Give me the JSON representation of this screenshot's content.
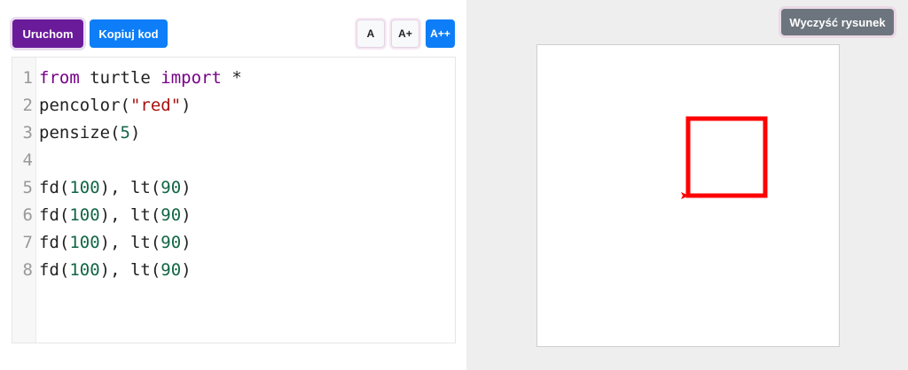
{
  "toolbar": {
    "run_label": "Uruchom",
    "copy_label": "Kopiuj kod",
    "font_small_label": "A",
    "font_medium_label": "A+",
    "font_large_label": "A++"
  },
  "canvas_toolbar": {
    "clear_label": "Wyczyść rysunek"
  },
  "editor": {
    "line_numbers": [
      "1",
      "2",
      "3",
      "4",
      "5",
      "6",
      "7",
      "8"
    ],
    "lines": [
      [
        {
          "t": "from",
          "c": "kw"
        },
        {
          "t": " turtle ",
          "c": ""
        },
        {
          "t": "import",
          "c": "kw"
        },
        {
          "t": " *",
          "c": ""
        }
      ],
      [
        {
          "t": "pencolor(",
          "c": ""
        },
        {
          "t": "\"red\"",
          "c": "str"
        },
        {
          "t": ")",
          "c": ""
        }
      ],
      [
        {
          "t": "pensize(",
          "c": ""
        },
        {
          "t": "5",
          "c": "num"
        },
        {
          "t": ")",
          "c": ""
        }
      ],
      [],
      [
        {
          "t": "fd(",
          "c": ""
        },
        {
          "t": "100",
          "c": "num"
        },
        {
          "t": "), lt(",
          "c": ""
        },
        {
          "t": "90",
          "c": "num"
        },
        {
          "t": ")",
          "c": ""
        }
      ],
      [
        {
          "t": "fd(",
          "c": ""
        },
        {
          "t": "100",
          "c": "num"
        },
        {
          "t": "), lt(",
          "c": ""
        },
        {
          "t": "90",
          "c": "num"
        },
        {
          "t": ")",
          "c": ""
        }
      ],
      [
        {
          "t": "fd(",
          "c": ""
        },
        {
          "t": "100",
          "c": "num"
        },
        {
          "t": "), lt(",
          "c": ""
        },
        {
          "t": "90",
          "c": "num"
        },
        {
          "t": ")",
          "c": ""
        }
      ],
      [
        {
          "t": "fd(",
          "c": ""
        },
        {
          "t": "100",
          "c": "num"
        },
        {
          "t": "), lt(",
          "c": ""
        },
        {
          "t": "90",
          "c": "num"
        },
        {
          "t": ")",
          "c": ""
        }
      ]
    ]
  },
  "drawing": {
    "pen_color": "#ff0000",
    "pen_size": 5,
    "side": 100
  },
  "colors": {
    "run_button": "#6a1b9a",
    "copy_button": "#0d7ef7",
    "clear_button": "#6c757d"
  }
}
